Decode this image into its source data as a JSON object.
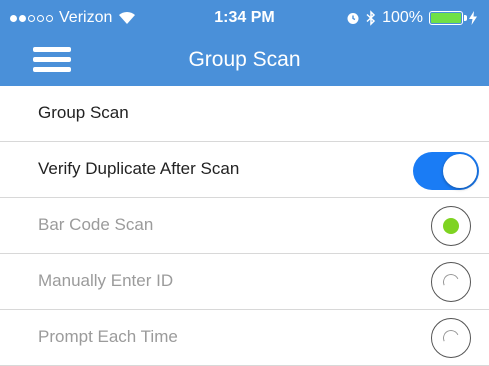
{
  "status_bar": {
    "carrier": "Verizon",
    "signal_dots_filled": 2,
    "signal_dots_total": 5,
    "time": "1:34 PM",
    "battery_text": "100%",
    "battery_level": 1.0,
    "icons": [
      "wifi-icon",
      "alarm-icon",
      "bluetooth-icon",
      "battery-icon",
      "charging-icon"
    ]
  },
  "nav": {
    "title": "Group Scan",
    "menu_icon": "hamburger-menu-icon"
  },
  "list": {
    "group_scan_label": "Group Scan",
    "verify_duplicate_label": "Verify Duplicate After Scan",
    "verify_duplicate_on": true,
    "options": [
      {
        "label": "Bar Code Scan",
        "selected": true
      },
      {
        "label": "Manually Enter ID",
        "selected": false
      },
      {
        "label": "Prompt Each Time",
        "selected": false
      }
    ]
  },
  "colors": {
    "header_bg": "#4a90d9",
    "toggle_on": "#1a7cf5",
    "radio_selected": "#7ed321",
    "battery_fill": "#6fe046"
  }
}
